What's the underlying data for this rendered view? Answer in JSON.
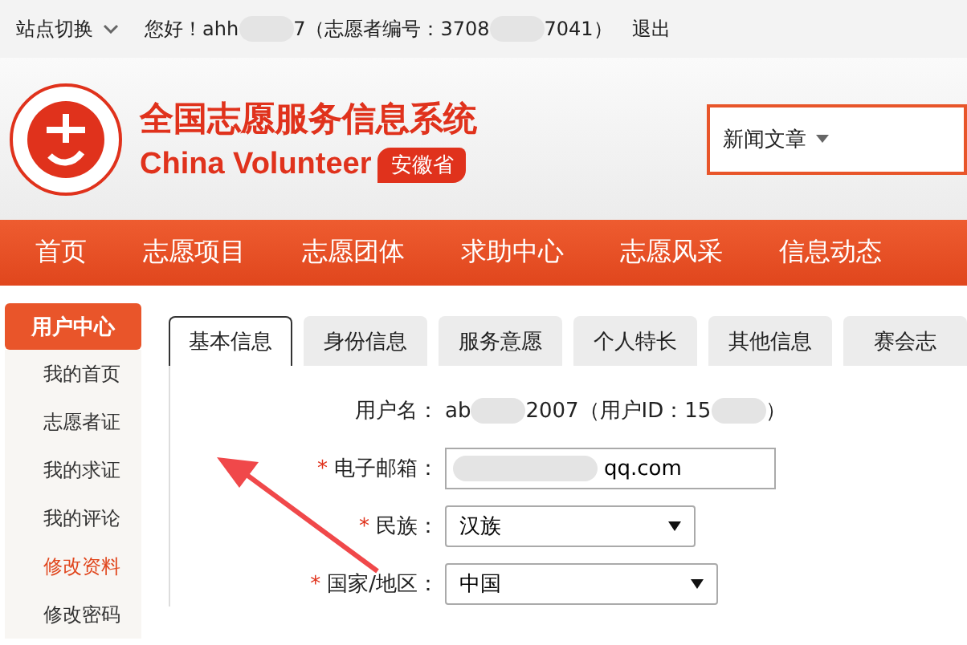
{
  "top_bar": {
    "site_switch": "站点切换",
    "greeting": [
      {
        "kind": "text",
        "text": "您好！ahh"
      },
      {
        "kind": "blur"
      },
      {
        "kind": "text",
        "text": "7（志愿者编号：3708"
      },
      {
        "kind": "blur"
      },
      {
        "kind": "text",
        "text": "7041）"
      }
    ],
    "logout": "退出"
  },
  "header": {
    "title": "全国志愿服务信息系统",
    "subtitle": "China Volunteer",
    "province": "安徽省",
    "search_category": "新闻文章"
  },
  "nav": [
    "首页",
    "志愿项目",
    "志愿团体",
    "求助中心",
    "志愿风采",
    "信息动态"
  ],
  "sidebar": {
    "title": "用户中心",
    "items": [
      {
        "label": "我的首页",
        "selected": false
      },
      {
        "label": "志愿者证",
        "selected": false
      },
      {
        "label": "我的求证",
        "selected": false
      },
      {
        "label": "我的评论",
        "selected": false
      },
      {
        "label": "修改资料",
        "selected": true
      },
      {
        "label": "修改密码",
        "selected": false
      }
    ]
  },
  "tabs": [
    {
      "label": "基本信息",
      "selected": true
    },
    {
      "label": "身份信息",
      "selected": false
    },
    {
      "label": "服务意愿",
      "selected": false
    },
    {
      "label": "个人特长",
      "selected": false
    },
    {
      "label": "其他信息",
      "selected": false
    },
    {
      "label": "赛会志",
      "selected": false
    }
  ],
  "form": [
    {
      "kind": "text",
      "label": "用户名：",
      "parts": [
        {
          "kind": "text",
          "text": "ab"
        },
        {
          "kind": "blur"
        },
        {
          "kind": "text",
          "text": "2007（用户ID：15"
        },
        {
          "kind": "blur"
        },
        {
          "kind": "text",
          "text": "）"
        }
      ]
    },
    {
      "kind": "input",
      "label": "电子邮箱：",
      "required_mark": "*",
      "parts": [
        {
          "kind": "blur"
        },
        {
          "kind": "text",
          "text": "qq.com"
        }
      ]
    },
    {
      "kind": "select",
      "label": "民族：",
      "required_mark": "*",
      "value": "汉族"
    },
    {
      "kind": "select",
      "label": "国家/地区：",
      "required_mark": "*",
      "value": "中国"
    }
  ]
}
